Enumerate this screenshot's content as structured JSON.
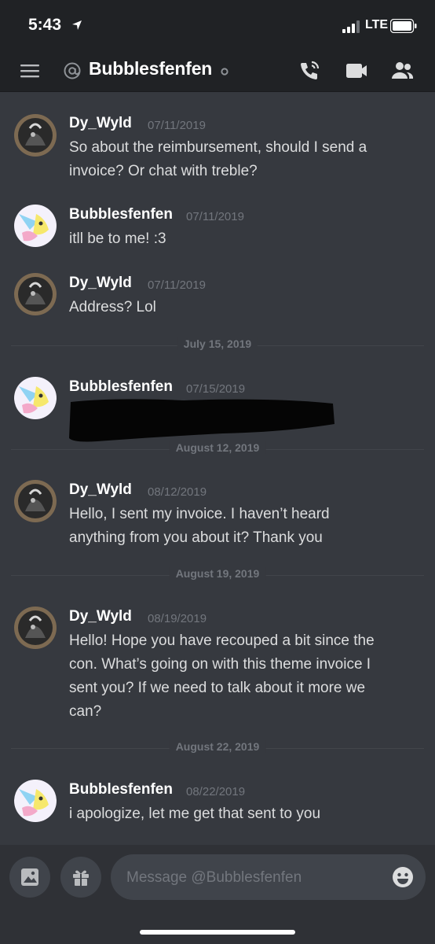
{
  "status_bar": {
    "time": "5:43",
    "network": "LTE"
  },
  "header": {
    "title": "Bubblesfenfen",
    "icons": {
      "menu": "hamburger-menu-icon",
      "at": "at-sign-icon",
      "call": "phone-call-icon",
      "video": "video-camera-icon",
      "members": "members-icon"
    }
  },
  "messages": [
    {
      "author": "Dy_Wyld",
      "timestamp": "07/11/2019",
      "lines": [
        "So about the reimbursement, should I send a",
        "invoice? Or chat with treble?"
      ]
    },
    {
      "author": "Bubblesfenfen",
      "timestamp": "07/11/2019",
      "lines": [
        "itll be to me! :3"
      ]
    },
    {
      "author": "Dy_Wyld",
      "timestamp": "07/11/2019",
      "lines": [
        "Address? Lol"
      ]
    },
    {
      "author": "Bubblesfenfen",
      "timestamp": "07/15/2019",
      "lines": []
    },
    {
      "author": "Dy_Wyld",
      "timestamp": "08/12/2019",
      "lines": [
        "Hello, I sent my invoice. I haven’t heard",
        "anything from you about it? Thank you"
      ]
    },
    {
      "author": "Dy_Wyld",
      "timestamp": "08/19/2019",
      "lines": [
        "Hello! Hope you have recouped a bit since the",
        "con. What’s going on with this theme invoice I",
        "sent you? If we need to talk about it more we",
        "can?"
      ]
    },
    {
      "author": "Bubblesfenfen",
      "timestamp": "08/22/2019",
      "lines": [
        "i apologize, let me get that sent to you"
      ]
    }
  ],
  "dividers": [
    "July 15, 2019",
    "August 12, 2019",
    "August 19, 2019",
    "August 22, 2019"
  ],
  "composer": {
    "placeholder": "Message @Bubblesfenfen",
    "icons": {
      "image": "image-icon",
      "gift": "gift-icon",
      "emoji": "emoji-icon"
    }
  },
  "colors": {
    "background": "#36393f",
    "header": "#202225",
    "accent_online": "#43b581",
    "muted_text": "#72767d"
  }
}
